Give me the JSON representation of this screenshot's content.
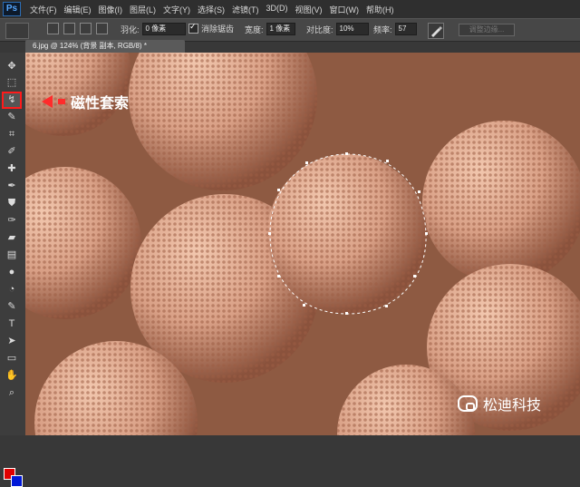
{
  "app": {
    "logo": "Ps",
    "menu": [
      "文件(F)",
      "编辑(E)",
      "图像(I)",
      "图层(L)",
      "文字(Y)",
      "选择(S)",
      "滤镜(T)",
      "3D(D)",
      "视图(V)",
      "窗口(W)",
      "帮助(H)"
    ]
  },
  "options": {
    "feather_label": "羽化:",
    "feather_value": "0 像素",
    "antialias_label": "消除锯齿",
    "width_label": "宽度:",
    "width_value": "1 像素",
    "contrast_label": "对比度:",
    "contrast_value": "10%",
    "frequency_label": "频率:",
    "frequency_value": "57",
    "refine_edge_label": "调整边缘..."
  },
  "document": {
    "tab_title": "6.jpg @ 124% (背景 副本, RGB/8) *"
  },
  "annotation": {
    "label": "磁性套索"
  },
  "watermark": {
    "text": "松迪科技"
  },
  "colors": {
    "highlight": "#ff1b1b",
    "foreground": "#e00000",
    "background": "#0018d8",
    "canvas": "#8e5a42"
  },
  "toolbar": {
    "icons": [
      "move-icon",
      "marquee-icon",
      "magnetic-lasso-icon",
      "quick-select-icon",
      "crop-icon",
      "eyedropper-icon",
      "healing-brush-icon",
      "brush-icon",
      "clone-stamp-icon",
      "history-brush-icon",
      "eraser-icon",
      "gradient-icon",
      "blur-icon",
      "dodge-icon",
      "pen-icon",
      "text-icon",
      "path-select-icon",
      "shape-icon",
      "hand-icon",
      "zoom-icon"
    ]
  }
}
